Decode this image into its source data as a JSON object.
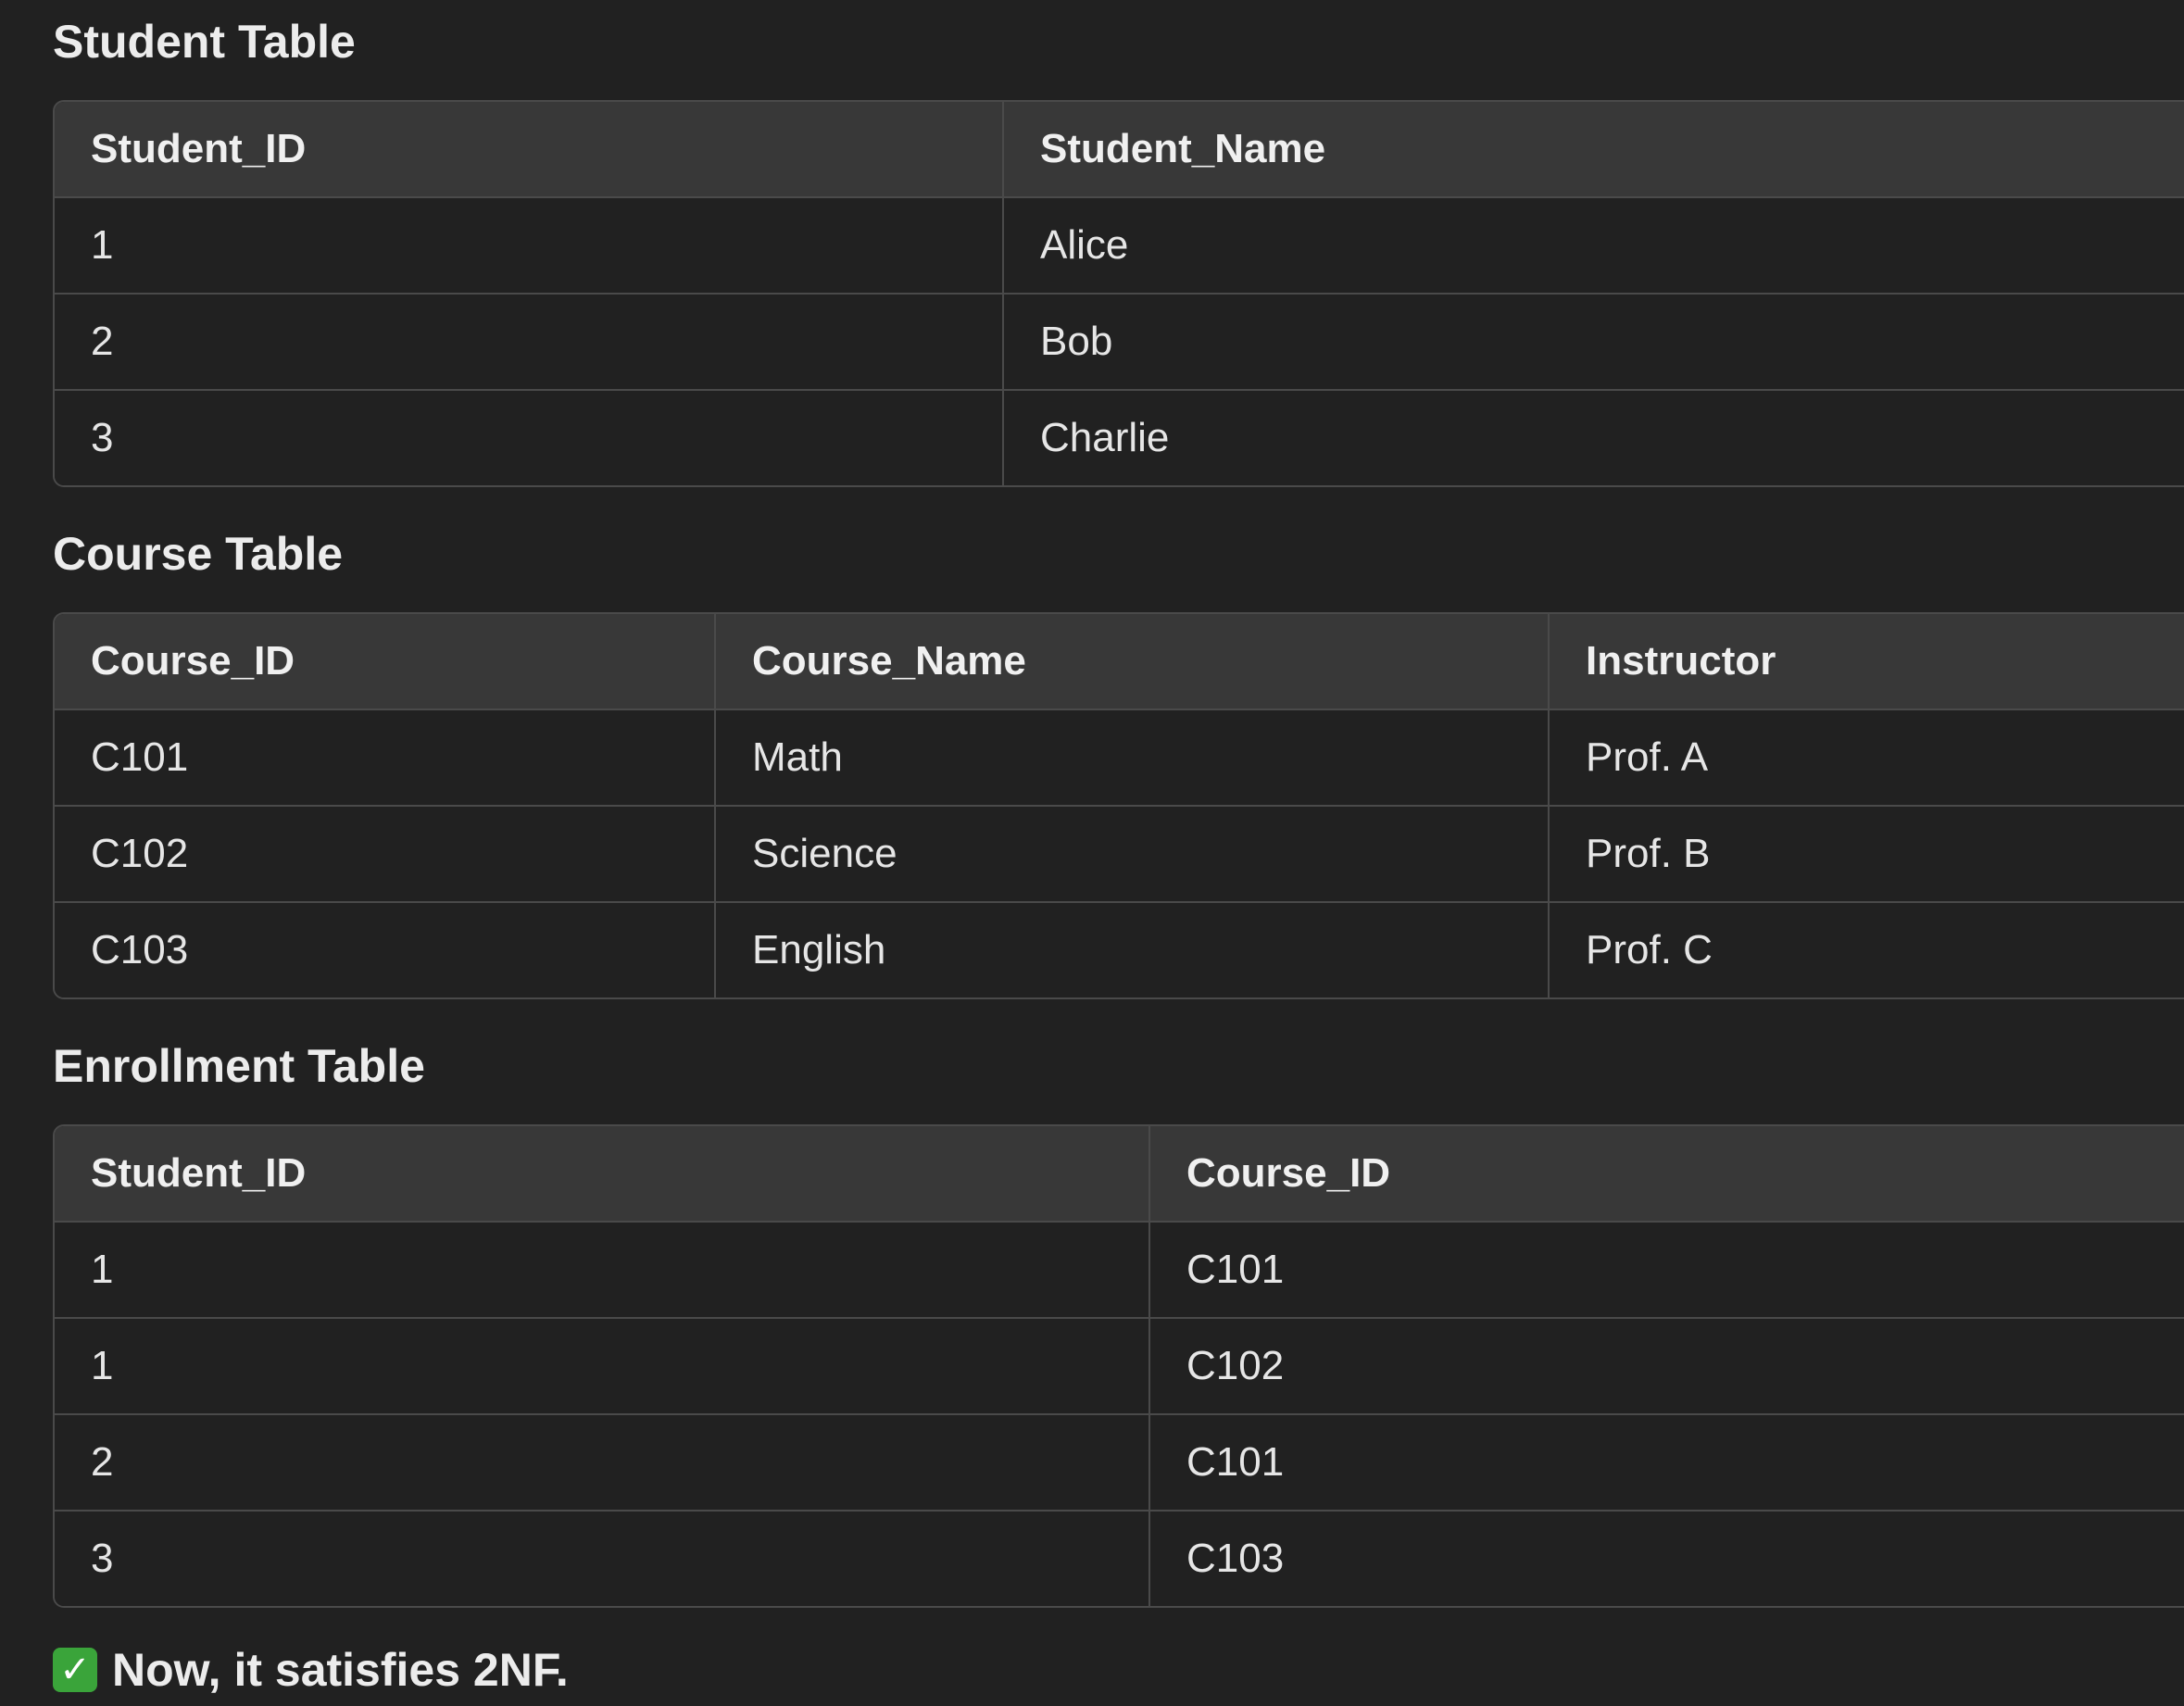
{
  "tables": [
    {
      "title": "Student Table",
      "headers": [
        "Student_ID",
        "Student_Name"
      ],
      "rows": [
        [
          "1",
          "Alice"
        ],
        [
          "2",
          "Bob"
        ],
        [
          "3",
          "Charlie"
        ]
      ]
    },
    {
      "title": "Course Table",
      "headers": [
        "Course_ID",
        "Course_Name",
        "Instructor"
      ],
      "rows": [
        [
          "C101",
          "Math",
          "Prof. A"
        ],
        [
          "C102",
          "Science",
          "Prof. B"
        ],
        [
          "C103",
          "English",
          "Prof. C"
        ]
      ]
    },
    {
      "title": "Enrollment Table",
      "headers": [
        "Student_ID",
        "Course_ID"
      ],
      "rows": [
        [
          "1",
          "C101"
        ],
        [
          "1",
          "C102"
        ],
        [
          "2",
          "C101"
        ],
        [
          "3",
          "C103"
        ]
      ]
    }
  ],
  "footer": {
    "icon": "check-mark-button-icon",
    "text": "Now, it satisfies 2NF."
  }
}
